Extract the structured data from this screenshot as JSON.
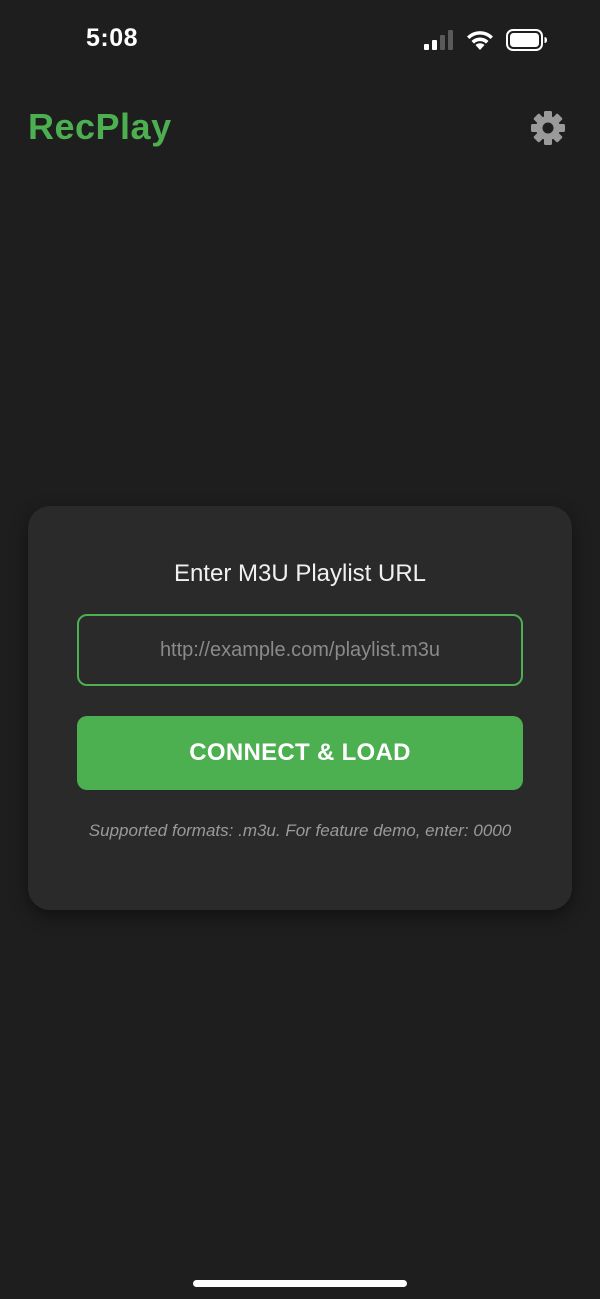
{
  "status_bar": {
    "time": "5:08",
    "icons": [
      "cellular-signal-icon",
      "wifi-icon",
      "battery-icon"
    ]
  },
  "header": {
    "title": "RecPlay",
    "settings_icon": "gear-icon"
  },
  "playlist_card": {
    "title": "Enter M3U Playlist URL",
    "url_input": {
      "value": "",
      "placeholder": "http://example.com/playlist.m3u"
    },
    "connect_button_label": "CONNECT & LOAD",
    "hint": "Supported formats: .m3u. For feature demo, enter: 0000"
  },
  "colors": {
    "accent": "#4caf50",
    "background": "#1e1e1e",
    "card": "#2a2a2a"
  }
}
